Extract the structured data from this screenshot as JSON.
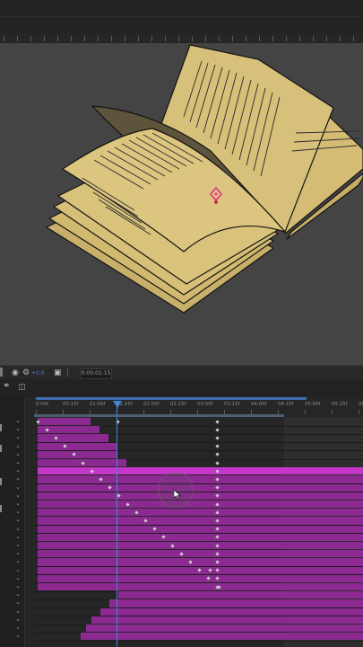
{
  "timeline": {
    "timecode": "0:00:01:15",
    "exposure_value": "+0.0",
    "ruler_ticks": [
      "0:00f",
      "00:15f",
      "01:00f",
      "01:15f",
      "02:00f",
      "02:15f",
      "03:00f",
      "03:15f",
      "04:00f",
      "04:15f",
      "05:00f",
      "05:15f",
      "06:00"
    ]
  },
  "colors": {
    "canvas_bg": "#444444",
    "book_page": "#d2bb72",
    "layer_bar": "#8c2a92",
    "layer_bar_selected": "#c537c9",
    "playhead": "#3f86d8",
    "anchor_point": "#e8308a"
  },
  "icons": [
    "link-icon",
    "keyframe-graph-icon",
    "color-wheel-icon",
    "settings-icon",
    "camera-icon"
  ]
}
